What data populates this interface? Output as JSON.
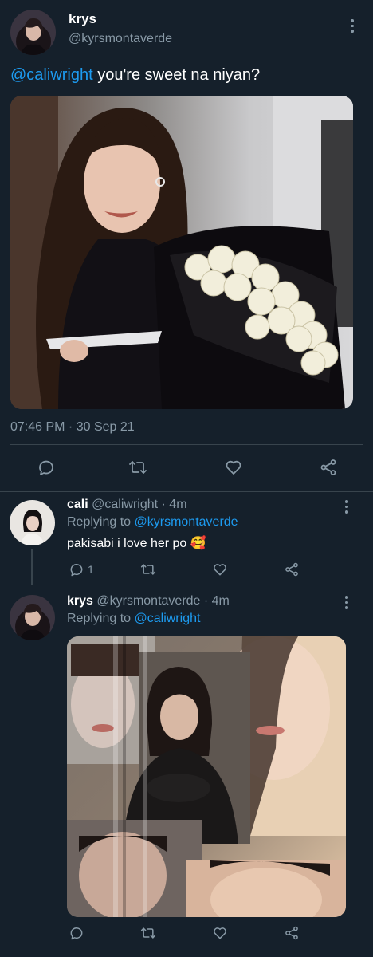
{
  "main_tweet": {
    "display_name": "krys",
    "handle": "@kyrsmontaverde",
    "mention": "@caliwright",
    "text": " you're sweet na niyan?",
    "timestamp": "07:46 PM · 30 Sep 21",
    "image_alt": "photo of a woman holding a bouquet of white roses wrapped in black paper"
  },
  "reply_1": {
    "display_name": "cali",
    "handle": "@caliwright",
    "time": " · 4m",
    "replying_prefix": "Replying to ",
    "replying_to": "@kyrsmontaverde",
    "text": "pakisabi i love her po",
    "emoji": "🥰",
    "reply_count": "1"
  },
  "reply_2": {
    "display_name": "krys",
    "handle": "@kyrsmontaverde",
    "time": " · 4m",
    "replying_prefix": "Replying to ",
    "replying_to": "@caliwright",
    "image_alt": "collage of close-up portraits of a woman with bangs"
  },
  "icons": [
    "comment-icon",
    "retweet-icon",
    "like-icon",
    "share-icon",
    "more-icon"
  ],
  "colors": {
    "background": "#15202b",
    "link": "#1d9bf0",
    "muted": "#8899a6",
    "divider": "#38444d"
  }
}
